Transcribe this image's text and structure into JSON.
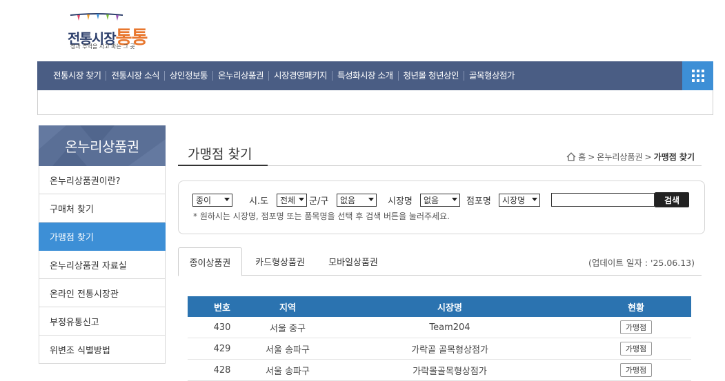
{
  "logo": {
    "main": "전통시장",
    "accent": "통통",
    "tagline": "정과 추억을 사고 파는 그 곳"
  },
  "gnb": {
    "items": [
      "전통시장 찾기",
      "전통시장 소식",
      "상인정보통",
      "온누리상품권",
      "시장경영패키지",
      "특성화시장 소개",
      "청년몰 청년상인",
      "골목형상점가"
    ],
    "all_menu_icon": "grid-icon"
  },
  "lnb": {
    "title": "온누리상품권",
    "items": [
      "온누리상품권이란?",
      "구매처 찾기",
      "가맹점 찾기",
      "온누리상품권 자료실",
      "온라인 전통시장관",
      "부정유통신고",
      "위변조 식별방법"
    ],
    "active_index": 2
  },
  "page": {
    "title": "가맹점 찾기"
  },
  "breadcrumb": {
    "home": "홈",
    "sep": ">",
    "section": "온누리상품권",
    "current": "가맹점 찾기"
  },
  "search": {
    "type_value": "종이",
    "sido_label": "시.도",
    "sido_value": "전체",
    "gungu_label": "군/구",
    "gungu_value": "없음",
    "market_label": "시장명",
    "market_value": "없음",
    "store_label": "점포명",
    "store_select_value": "시장명",
    "keyword_value": "",
    "button_label": "검색",
    "note": "* 원하시는 시장명, 점포명 또는 품목명을 선택 후 검색 버튼을 눌러주세요."
  },
  "tabs": [
    "종이상품권",
    "카드형상품권",
    "모바일상품권"
  ],
  "update_text": "(업데이트 일자 : '25.06.13)",
  "table": {
    "headers": [
      "번호",
      "지역",
      "시장명",
      "현황"
    ],
    "rows": [
      {
        "no": "430",
        "region": "서울 중구",
        "market": "Team204",
        "status": "가맹점"
      },
      {
        "no": "429",
        "region": "서울 송파구",
        "market": "가락골 골목형상점가",
        "status": "가맹점"
      },
      {
        "no": "428",
        "region": "서울 송파구",
        "market": "가락몰골목형상점가",
        "status": "가맹점"
      }
    ]
  }
}
